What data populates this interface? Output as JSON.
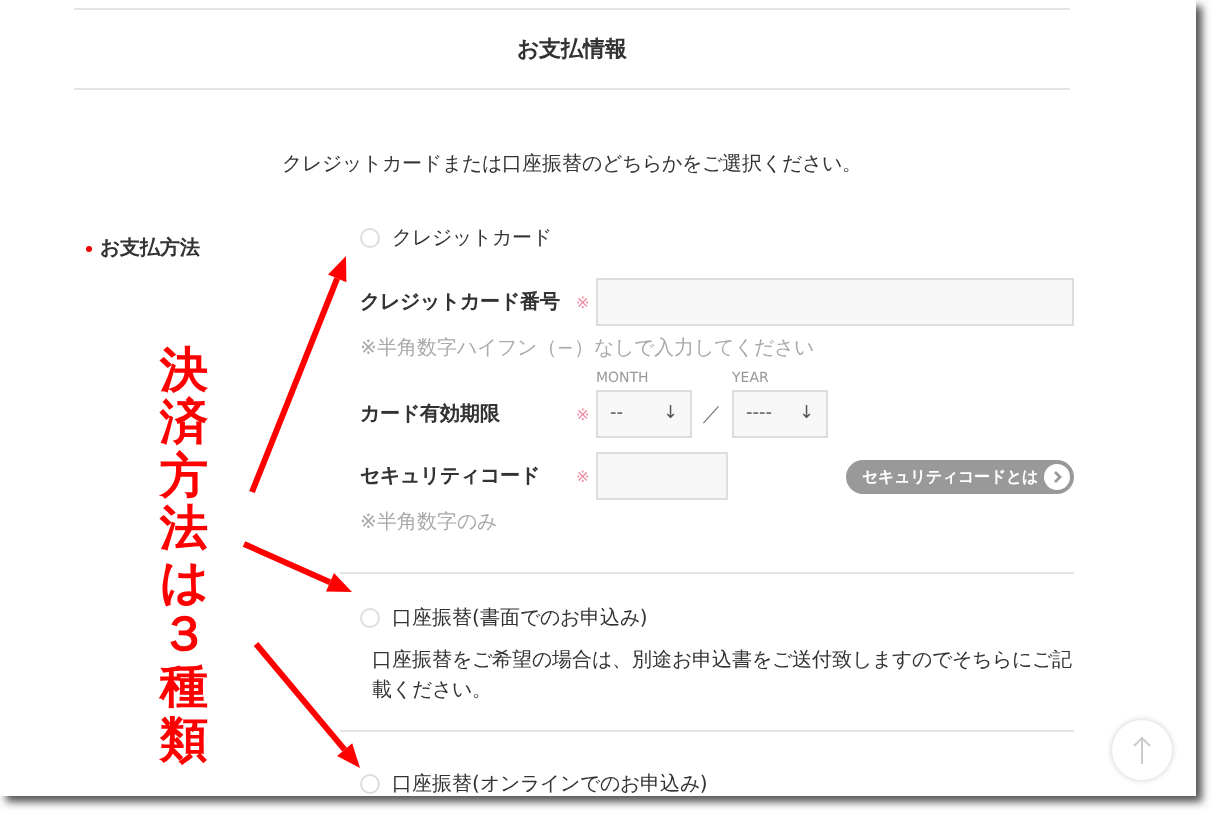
{
  "section_title": "お支払情報",
  "instruction": "クレジットカードまたは口座振替のどちらかをご選択ください。",
  "field_label": "お支払方法",
  "payment_options": [
    {
      "kind": "card",
      "label": "クレジットカード",
      "selected": false
    },
    {
      "kind": "transfer",
      "label": "口座振替(書面でのお申込み)",
      "selected": false,
      "note": "口座振替をご希望の場合は、別途お申込書をご送付致しますのでそちらにご記載ください。"
    },
    {
      "kind": "transfer",
      "label": "口座振替(オンラインでのお申込み)",
      "selected": false
    }
  ],
  "card_number": {
    "label": "クレジットカード番号",
    "required": "※",
    "hint": "※半角数字ハイフン（−）なしで入力してください"
  },
  "expiry": {
    "label": "カード有効期限",
    "required": "※",
    "month": {
      "caption": "MONTH",
      "value": "--",
      "arrow": "↓"
    },
    "separator": "／",
    "year": {
      "caption": "YEAR",
      "value": "----",
      "arrow": "↓"
    }
  },
  "security_code": {
    "label": "セキュリティコード",
    "required": "※",
    "help_button": "セキュリティコードとは",
    "hint": "※半角数字のみ"
  },
  "annotation": {
    "text": "決済方法は３種類"
  }
}
